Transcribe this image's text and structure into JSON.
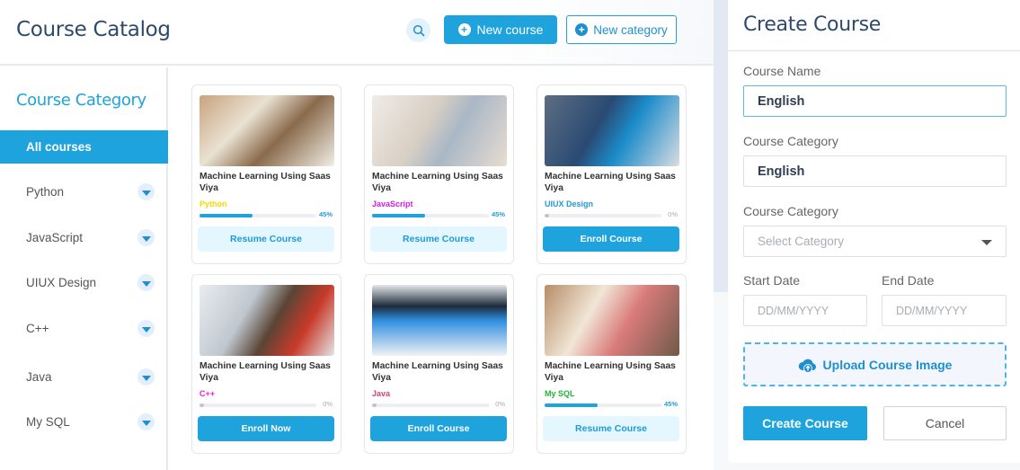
{
  "header": {
    "title": "Course Catalog",
    "search_icon": "search-icon",
    "new_course_label": "New course",
    "new_category_label": "New category"
  },
  "sidebar": {
    "title": "Course Category",
    "items": [
      {
        "label": "All courses",
        "active": true
      },
      {
        "label": "Python"
      },
      {
        "label": "JavaScript"
      },
      {
        "label": "UIUX Design"
      },
      {
        "label": "C++"
      },
      {
        "label": "Java"
      },
      {
        "label": "My SQL"
      }
    ]
  },
  "courses": [
    {
      "title": "Machine Learning Using Saas Viya",
      "category": "Python",
      "category_color": "#f5d800",
      "progress": 45,
      "progress_label": "45%",
      "button": "Resume Course",
      "button_type": "resume"
    },
    {
      "title": "Machine Learning Using Saas Viya",
      "category": "JavaScript",
      "category_color": "#d21ee6",
      "progress": 45,
      "progress_label": "45%",
      "button": "Resume Course",
      "button_type": "resume"
    },
    {
      "title": "Machine Learning Using Saas Viya",
      "category": "UIUX Design",
      "category_color": "#1f9bd7",
      "progress": 0,
      "progress_label": "0%",
      "button": "Enroll Course",
      "button_type": "enroll"
    },
    {
      "title": "Machine Learning Using Saas Viya",
      "category": "C++",
      "category_color": "#e81fd0",
      "progress": 0,
      "progress_label": "0%",
      "button": "Enroll Now",
      "button_type": "enroll"
    },
    {
      "title": "Machine Learning Using Saas Viya",
      "category": "Java",
      "category_color": "#c9447a",
      "progress": 0,
      "progress_label": "0%",
      "button": "Enroll Course",
      "button_type": "enroll"
    },
    {
      "title": "Machine Learning Using Saas Viya",
      "category": "My SQL",
      "category_color": "#22b534",
      "progress": 45,
      "progress_label": "45%",
      "button": "Resume Course",
      "button_type": "resume"
    }
  ],
  "panel": {
    "title": "Create Course",
    "course_name_label": "Course Name",
    "course_name_value": "English",
    "course_category_label": "Course Category",
    "course_category_value": "English",
    "course_category2_label": "Course Category",
    "select_placeholder": "Select Category",
    "start_date_label": "Start Date",
    "start_date_placeholder": "DD/MM/YYYY",
    "end_date_label": "End Date",
    "end_date_placeholder": "DD/MM/YYYY",
    "upload_label": "Upload Course Image",
    "create_label": "Create Course",
    "cancel_label": "Cancel"
  }
}
